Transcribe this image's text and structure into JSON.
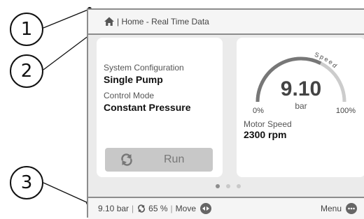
{
  "callouts": [
    "1",
    "2",
    "3"
  ],
  "breadcrumb": {
    "icon": "home-icon",
    "text": "| Home - Real Time Data"
  },
  "config_card": {
    "system_configuration_label": "System Configuration",
    "system_configuration_value": "Single Pump",
    "control_mode_label": "Control Mode",
    "control_mode_value": "Constant Pressure",
    "run_button": {
      "icon": "refresh-icon",
      "label": "Run"
    }
  },
  "gauge_card": {
    "value": "9.10",
    "unit": "bar",
    "min_label": "0%",
    "max_label": "100%",
    "arc_label": "Speed",
    "speed_fraction": 0.65,
    "motor_speed_label": "Motor Speed",
    "motor_speed_value": "2300 rpm"
  },
  "pager": {
    "count": 3,
    "active_index": 0
  },
  "status_bar": {
    "pressure": "9.10 bar",
    "speed_percent": "65 %",
    "move_label": "Move",
    "menu_label": "Menu"
  },
  "colors": {
    "arc_active": "#777777",
    "arc_track": "#cccccc",
    "button_bg": "#c8c8c8"
  }
}
